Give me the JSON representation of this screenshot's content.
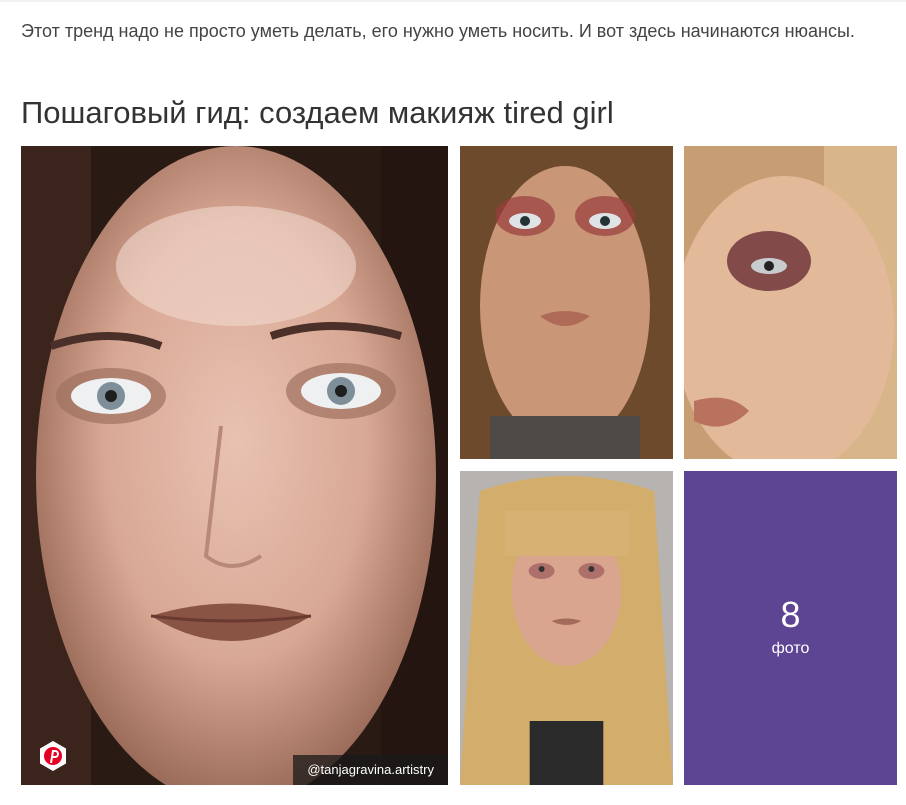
{
  "article": {
    "intro_text": "Этот тренд надо не просто уметь делать, его нужно уметь носить. И вот здесь начинаются нюансы.",
    "section_heading": "Пошаговый гид: создаем макияж tired girl"
  },
  "gallery": {
    "photo_credit": "@tanjagravina.artistry",
    "more_count": "8",
    "more_label": "фото",
    "pinterest_icon": "pinterest-icon",
    "more_tile_color": "#5e4594"
  }
}
